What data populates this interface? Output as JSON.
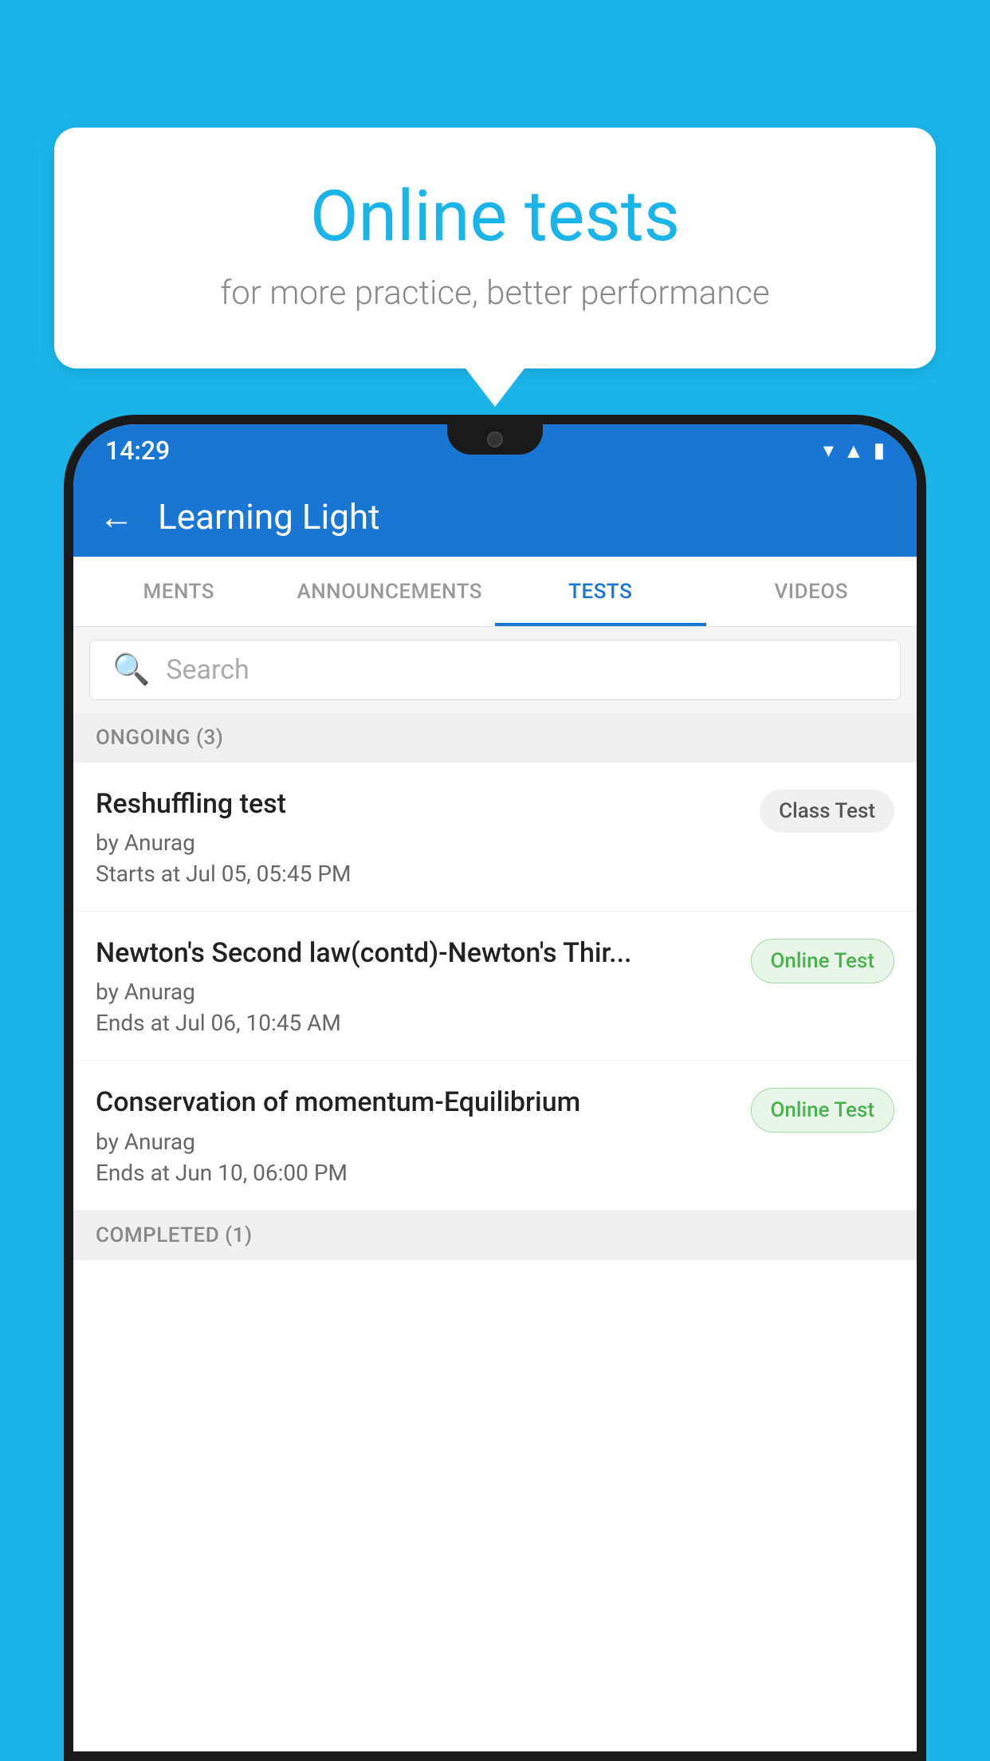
{
  "background": {
    "color": "#1ab4e8"
  },
  "speech_bubble": {
    "title": "Online tests",
    "subtitle": "for more practice, better performance"
  },
  "phone": {
    "status_bar": {
      "time": "14:29",
      "icons": [
        "wifi",
        "signal",
        "battery"
      ]
    },
    "app_bar": {
      "back_label": "←",
      "title": "Learning Light"
    },
    "tabs": [
      {
        "label": "MENTS",
        "active": false
      },
      {
        "label": "ANNOUNCEMENTS",
        "active": false
      },
      {
        "label": "TESTS",
        "active": true
      },
      {
        "label": "VIDEOS",
        "active": false
      }
    ],
    "search": {
      "placeholder": "Search"
    },
    "ongoing_section": {
      "label": "ONGOING (3)"
    },
    "test_items": [
      {
        "name": "Reshuffling test",
        "author": "by Anurag",
        "time_label": "Starts at",
        "time": "Jul 05, 05:45 PM",
        "badge": "Class Test",
        "badge_type": "class"
      },
      {
        "name": "Newton's Second law(contd)-Newton's Thir...",
        "author": "by Anurag",
        "time_label": "Ends at",
        "time": "Jul 06, 10:45 AM",
        "badge": "Online Test",
        "badge_type": "online"
      },
      {
        "name": "Conservation of momentum-Equilibrium",
        "author": "by Anurag",
        "time_label": "Ends at",
        "time": "Jun 10, 06:00 PM",
        "badge": "Online Test",
        "badge_type": "online"
      }
    ],
    "completed_section": {
      "label": "COMPLETED (1)"
    }
  }
}
